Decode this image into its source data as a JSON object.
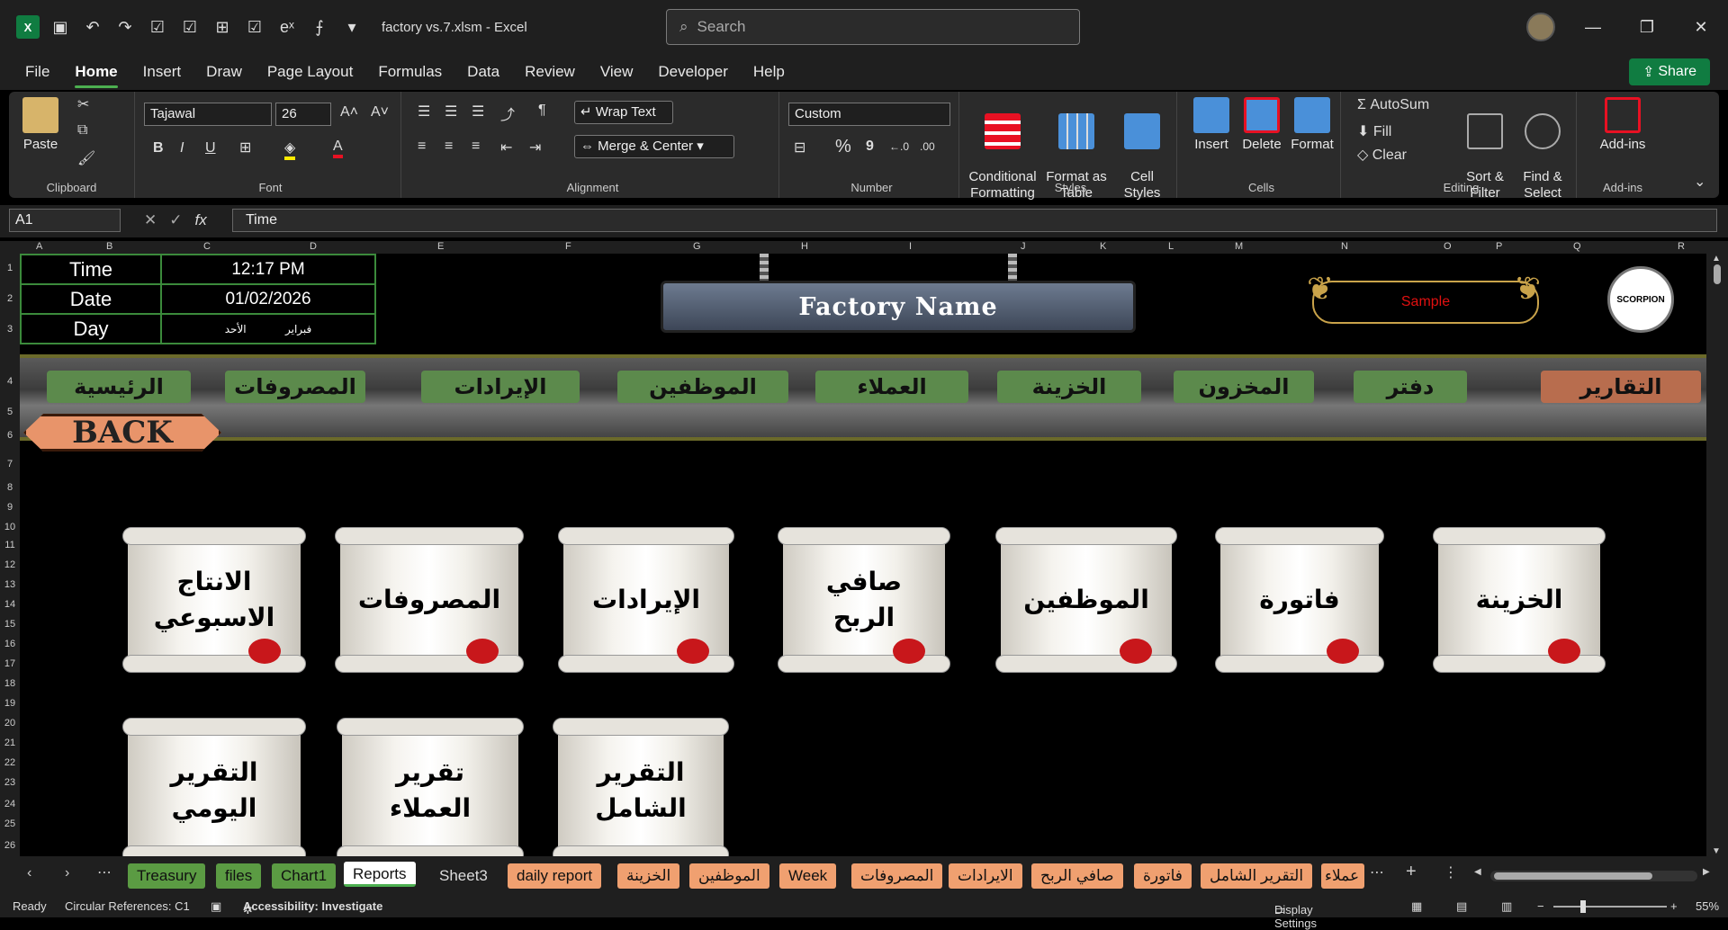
{
  "window": {
    "file_name": "factory vs.7.xlsm",
    "app_name": "Excel",
    "title_sep": "-",
    "search_placeholder": "Search",
    "share_label": "Share"
  },
  "menu": [
    "File",
    "Home",
    "Insert",
    "Draw",
    "Page Layout",
    "Formulas",
    "Data",
    "Review",
    "View",
    "Developer",
    "Help"
  ],
  "ribbon": {
    "clipboard": {
      "paste": "Paste",
      "label": "Clipboard"
    },
    "font": {
      "name": "Tajawal",
      "size": "26",
      "label": "Font",
      "bold": "B",
      "italic": "I",
      "underline": "U"
    },
    "alignment": {
      "wrap": "Wrap Text",
      "merge": "Merge & Center",
      "label": "Alignment"
    },
    "number": {
      "format": "Custom",
      "label": "Number",
      "percent": "%",
      "comma": "9"
    },
    "styles": {
      "cond": "Conditional\nFormatting",
      "table": "Format as\nTable",
      "cell": "Cell\nStyles",
      "label": "Styles"
    },
    "cells": {
      "insert": "Insert",
      "delete": "Delete",
      "format": "Format",
      "label": "Cells"
    },
    "editing": {
      "autosum": "AutoSum",
      "fill": "Fill",
      "clear": "Clear",
      "sort": "Sort &\nFilter",
      "find": "Find &\nSelect",
      "label": "Editing"
    },
    "addins": {
      "addins": "Add-ins",
      "label": "Add-ins"
    }
  },
  "formula_bar": {
    "name_box": "A1",
    "content": "Time"
  },
  "columns": [
    "A",
    "B",
    "C",
    "D",
    "E",
    "F",
    "G",
    "H",
    "I",
    "J",
    "K",
    "L",
    "M",
    "N",
    "O",
    "P",
    "Q",
    "R"
  ],
  "rows": [
    "1",
    "2",
    "3",
    "4",
    "5",
    "6",
    "7",
    "8",
    "9",
    "10",
    "11",
    "12",
    "13",
    "14",
    "15",
    "16",
    "17",
    "18",
    "19",
    "20",
    "21",
    "22",
    "23",
    "24",
    "25",
    "26"
  ],
  "info": {
    "time_label": "Time",
    "time_value": "12:17 PM",
    "date_label": "Date",
    "date_value": "01/02/2026",
    "day_label": "Day",
    "day_value_1": "فبراير",
    "day_value_2": "الأحد"
  },
  "banner": {
    "title": "Factory Name",
    "sample": "Sample",
    "logo": "SCORPION"
  },
  "nav": [
    "الرئيسية",
    "المصروفات",
    "الإيرادات",
    "الموظفين",
    "العملاء",
    "الخزينة",
    "المخزون",
    "دفتر",
    "التقارير"
  ],
  "back_label": "BACK",
  "scrolls_row1": [
    "الانتاج\nالاسبوعي",
    "المصروفات",
    "الإيرادات",
    "صافي\nالربح",
    "الموظفين",
    "فاتورة",
    "الخزينة"
  ],
  "scrolls_row2": [
    "التقرير\nاليومي",
    "تقرير\nالعملاء",
    "التقرير\nالشامل"
  ],
  "sheet_tabs": [
    {
      "label": "Treasury",
      "style": "green"
    },
    {
      "label": "files",
      "style": "green"
    },
    {
      "label": "Chart1",
      "style": "green"
    },
    {
      "label": "Reports",
      "style": "active"
    },
    {
      "label": "Sheet3",
      "style": "plain"
    },
    {
      "label": "daily report",
      "style": "orange"
    },
    {
      "label": "الخزينة",
      "style": "orange"
    },
    {
      "label": "الموظفين",
      "style": "orange"
    },
    {
      "label": "Week",
      "style": "orange"
    },
    {
      "label": "المصروفات",
      "style": "orange"
    },
    {
      "label": "الايرادات",
      "style": "orange"
    },
    {
      "label": "صافي الربح",
      "style": "orange"
    },
    {
      "label": "فاتورة",
      "style": "orange"
    },
    {
      "label": "التقرير الشامل",
      "style": "orange"
    },
    {
      "label": "عملاء",
      "style": "orange"
    }
  ],
  "status": {
    "ready": "Ready",
    "circular": "Circular References: C1",
    "accessibility": "Accessibility: Investigate",
    "display": "Display Settings",
    "zoom": "55%"
  },
  "colors": {
    "accent": "#107c41",
    "nav_green": "#5c8a4c",
    "nav_active": "#b86d4e",
    "seal": "#c8171b"
  }
}
